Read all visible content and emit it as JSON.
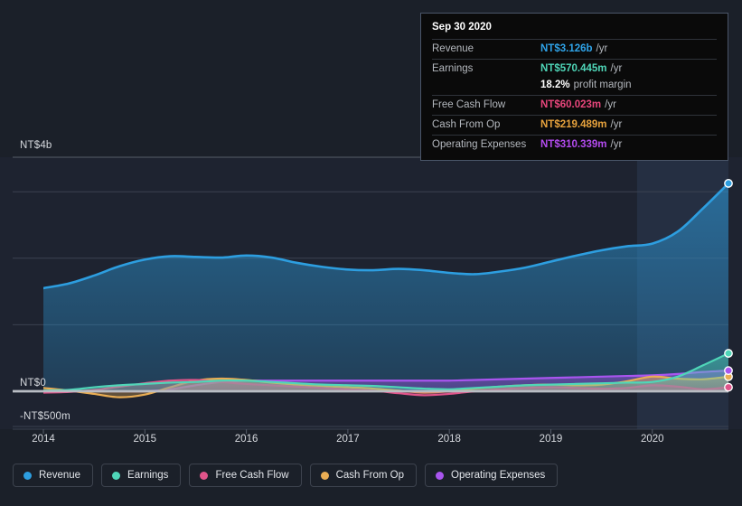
{
  "tooltip": {
    "date": "Sep 30 2020",
    "rows": [
      {
        "key": "Revenue",
        "value": "NT$3.126b",
        "unit": "/yr",
        "color": "#2fa3e8"
      },
      {
        "key": "Earnings",
        "value": "NT$570.445m",
        "unit": "/yr",
        "color": "#4fd6b8"
      },
      {
        "key": "",
        "value": "18.2%",
        "unit": "profit margin",
        "color": "#ffffff",
        "sub": true
      },
      {
        "key": "Free Cash Flow",
        "value": "NT$60.023m",
        "unit": "/yr",
        "color": "#e8467c"
      },
      {
        "key": "Cash From Op",
        "value": "NT$219.489m",
        "unit": "/yr",
        "color": "#e8a33d"
      },
      {
        "key": "Operating Expenses",
        "value": "NT$310.339m",
        "unit": "/yr",
        "color": "#b44bf0"
      }
    ]
  },
  "legend": [
    {
      "label": "Revenue",
      "color": "#2d9ee0"
    },
    {
      "label": "Earnings",
      "color": "#4fd6b8"
    },
    {
      "label": "Free Cash Flow",
      "color": "#e0548a"
    },
    {
      "label": "Cash From Op",
      "color": "#e9ad54"
    },
    {
      "label": "Operating Expenses",
      "color": "#a955ef"
    }
  ],
  "axis": {
    "y_top_label": "NT$4b",
    "y_zero_label": "NT$0",
    "y_neg_label": "-NT$500m",
    "x_labels": [
      "2014",
      "2015",
      "2016",
      "2017",
      "2018",
      "2019",
      "2020"
    ]
  },
  "chart_data": {
    "type": "area",
    "title": "",
    "xlabel": "",
    "ylabel": "NT$",
    "ylim": [
      -500000000,
      4000000000
    ],
    "y_ticks": [
      4000000000,
      0,
      -500000000
    ],
    "y_tick_labels": [
      "NT$4b",
      "NT$0",
      "-NT$500m"
    ],
    "x": [
      2014.0,
      2014.25,
      2014.5,
      2014.75,
      2015.0,
      2015.25,
      2015.5,
      2015.75,
      2016.0,
      2016.25,
      2016.5,
      2016.75,
      2017.0,
      2017.25,
      2017.5,
      2017.75,
      2018.0,
      2018.25,
      2018.5,
      2018.75,
      2019.0,
      2019.25,
      2019.5,
      2019.75,
      2020.0,
      2020.25,
      2020.5,
      2020.75
    ],
    "x_tick_labels": [
      "2014",
      "2015",
      "2016",
      "2017",
      "2018",
      "2019",
      "2020"
    ],
    "grid": true,
    "legend_position": "bottom",
    "highlight_region": {
      "from": 2019.85,
      "to": 2020.78
    },
    "units": "NT$ (billions)",
    "series": [
      {
        "name": "Revenue",
        "color": "#2d9ee0",
        "filled": true,
        "end_value": "NT$3.126b",
        "values": [
          1.55,
          1.62,
          1.74,
          1.88,
          1.98,
          2.03,
          2.02,
          2.01,
          2.04,
          2.01,
          1.93,
          1.87,
          1.83,
          1.82,
          1.84,
          1.82,
          1.78,
          1.76,
          1.8,
          1.86,
          1.95,
          2.04,
          2.12,
          2.18,
          2.22,
          2.4,
          2.75,
          3.126
        ]
      },
      {
        "name": "Earnings",
        "color": "#4fd6b8",
        "filled": true,
        "end_value": "NT$570.445m",
        "values": [
          0.01,
          0.02,
          0.06,
          0.09,
          0.11,
          0.13,
          0.14,
          0.16,
          0.16,
          0.14,
          0.12,
          0.1,
          0.09,
          0.08,
          0.06,
          0.04,
          0.03,
          0.05,
          0.07,
          0.09,
          0.1,
          0.11,
          0.12,
          0.13,
          0.14,
          0.22,
          0.39,
          0.57
        ]
      },
      {
        "name": "Free Cash Flow",
        "color": "#e0548a",
        "filled": true,
        "end_value": "NT$60.023m",
        "values": [
          -0.02,
          -0.01,
          0.02,
          0.07,
          0.12,
          0.16,
          0.17,
          0.14,
          0.11,
          0.09,
          0.07,
          0.05,
          0.03,
          0.01,
          -0.03,
          -0.06,
          -0.04,
          0.0,
          0.03,
          0.05,
          0.06,
          0.05,
          0.04,
          0.05,
          0.09,
          0.07,
          0.03,
          0.06
        ]
      },
      {
        "name": "Cash From Op",
        "color": "#e9ad54",
        "filled": true,
        "end_value": "NT$219.489m",
        "values": [
          0.05,
          0.01,
          -0.04,
          -0.09,
          -0.05,
          0.06,
          0.16,
          0.19,
          0.17,
          0.13,
          0.1,
          0.08,
          0.06,
          0.04,
          0.01,
          -0.02,
          0.0,
          0.04,
          0.07,
          0.09,
          0.1,
          0.09,
          0.1,
          0.15,
          0.22,
          0.19,
          0.18,
          0.219
        ]
      },
      {
        "name": "Operating Expenses",
        "color": "#a955ef",
        "filled": true,
        "end_value": "NT$310.339m",
        "values": [
          0.0,
          0.0,
          0.0,
          0.0,
          0.0,
          0.03,
          0.09,
          0.14,
          0.16,
          0.16,
          0.16,
          0.16,
          0.16,
          0.16,
          0.16,
          0.16,
          0.16,
          0.17,
          0.18,
          0.19,
          0.2,
          0.21,
          0.22,
          0.23,
          0.24,
          0.26,
          0.29,
          0.31
        ]
      }
    ]
  }
}
